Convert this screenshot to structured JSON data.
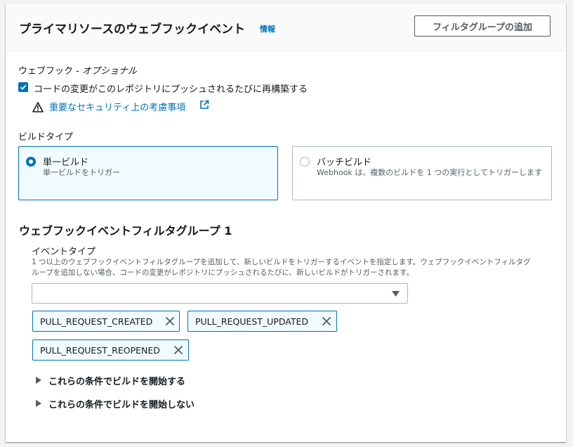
{
  "header": {
    "title": "プライマリソースのウェブフックイベント",
    "info": "情報",
    "add_filter_group": "フィルタグループの追加"
  },
  "webhook": {
    "label": "ウェブフック - ",
    "label_optional": "オプショナル",
    "checkbox_label": "コードの変更がこのレポジトリにプッシュされるたびに再構築する",
    "checked": true,
    "security_link": "重要なセキュリティ上の考慮事項"
  },
  "build_type": {
    "label": "ビルドタイプ",
    "options": [
      {
        "title": "単一ビルド",
        "desc": "単一ビルドをトリガー",
        "selected": true
      },
      {
        "title": "バッチビルド",
        "desc": "Webhook は、複数のビルドを 1 つの実行としてトリガーします",
        "selected": false
      }
    ]
  },
  "filter_group": {
    "title": "ウェブフックイベントフィルタグループ 1",
    "event_type_label": "イベントタイプ",
    "help": "1 つ以上のウェブフックイベントフィルタグループを追加して、新しいビルドをトリガーするイベントを指定します。ウェブフックイベントフィルタグループを追加しない場合、コードの変更がレポジトリにプッシュされるたびに、新しいビルドがトリガーされます。",
    "select_value": "",
    "tokens": [
      "PULL_REQUEST_CREATED",
      "PULL_REQUEST_UPDATED",
      "PULL_REQUEST_REOPENED"
    ],
    "expanders": [
      "これらの条件でビルドを開始する",
      "これらの条件でビルドを開始しない"
    ]
  },
  "colors": {
    "accent": "#0073bb",
    "text": "#16191f",
    "secondary": "#545b64",
    "border": "#aab7b8"
  }
}
